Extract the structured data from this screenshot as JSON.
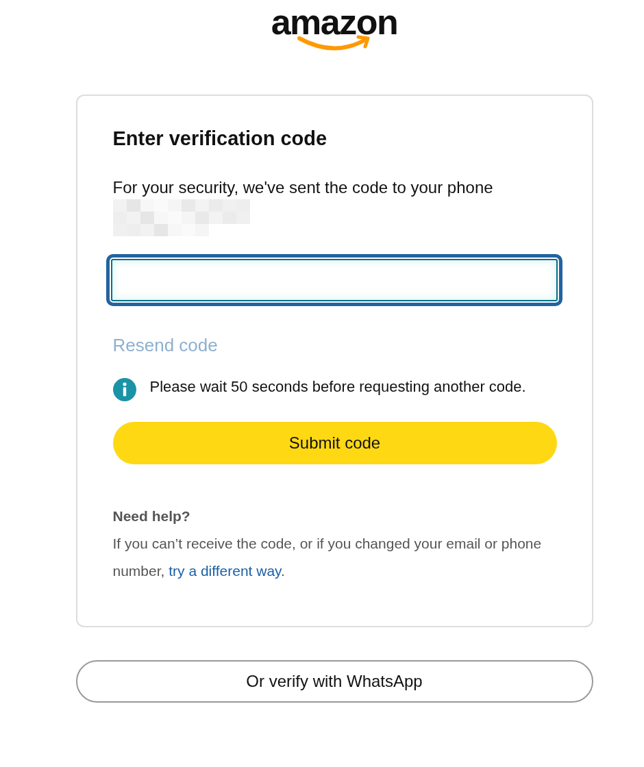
{
  "logo": {
    "text": "amazon"
  },
  "card": {
    "title": "Enter verification code",
    "message": "For your security, we've sent the code to your phone",
    "phone": {
      "kind": "redacted"
    },
    "code_field": {
      "focused": true
    },
    "resend": {
      "label": "Resend code",
      "disabled": true
    },
    "notice": {
      "text": "Please wait 50 seconds before requesting another code."
    },
    "submit": {
      "label": "Submit code"
    },
    "help": {
      "title": "Need help?",
      "text": "If you can’t receive the code, or if you changed your email or phone number, ",
      "link": "try a different way",
      "after": "."
    }
  },
  "alt_button": {
    "label": "Or verify with WhatsApp"
  }
}
